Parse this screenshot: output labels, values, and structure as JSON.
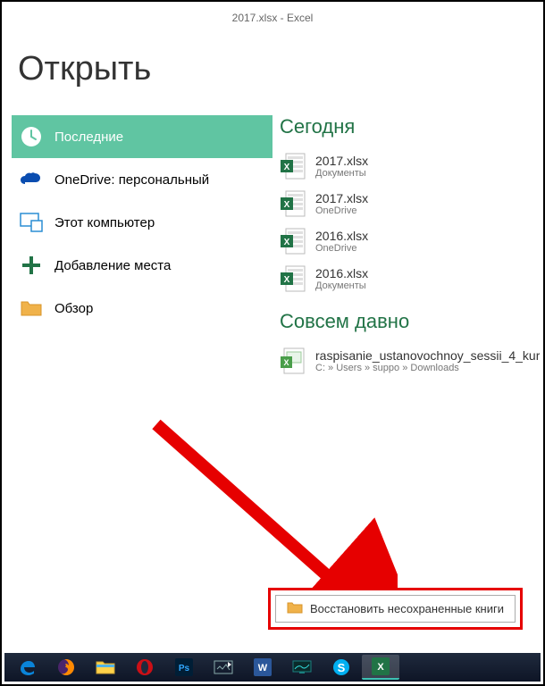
{
  "window": {
    "title": "2017.xlsx - Excel"
  },
  "page": {
    "heading": "Открыть"
  },
  "sidebar": {
    "items": [
      {
        "label": "Последние",
        "icon": "clock"
      },
      {
        "label": "OneDrive: персональный",
        "icon": "onedrive"
      },
      {
        "label": "Этот компьютер",
        "icon": "pc"
      },
      {
        "label": "Добавление места",
        "icon": "plus"
      },
      {
        "label": "Обзор",
        "icon": "folder"
      }
    ]
  },
  "sections": {
    "today": {
      "header": "Сегодня",
      "files": [
        {
          "name": "2017.xlsx",
          "path": "Документы",
          "icon": "xlsx"
        },
        {
          "name": "2017.xlsx",
          "path": "OneDrive",
          "icon": "xlsx"
        },
        {
          "name": "2016.xlsx",
          "path": "OneDrive",
          "icon": "xlsx"
        },
        {
          "name": "2016.xlsx",
          "path": "Документы",
          "icon": "xlsx"
        }
      ]
    },
    "longago": {
      "header": "Совсем давно",
      "files": [
        {
          "name": "raspisanie_ustanovochnoy_sessii_4_kur",
          "path": "C: » Users » suppo » Downloads",
          "icon": "xls"
        }
      ]
    }
  },
  "recover": {
    "label": "Восстановить несохраненные книги"
  },
  "taskbar": {
    "items": [
      {
        "icon": "edge",
        "color": "#0a84d9"
      },
      {
        "icon": "firefox",
        "color": "#ff8a00"
      },
      {
        "icon": "explorer",
        "color": "#ffd24a"
      },
      {
        "icon": "opera",
        "color": "#cc0f16"
      },
      {
        "icon": "photoshop",
        "color": "#001e36"
      },
      {
        "icon": "show-desktop",
        "color": "#888"
      },
      {
        "icon": "word",
        "color": "#2b579a"
      },
      {
        "icon": "monitor",
        "color": "#1a7f7f"
      },
      {
        "icon": "skype",
        "color": "#00aff0"
      },
      {
        "icon": "excel",
        "color": "#217346",
        "active": true
      }
    ]
  }
}
